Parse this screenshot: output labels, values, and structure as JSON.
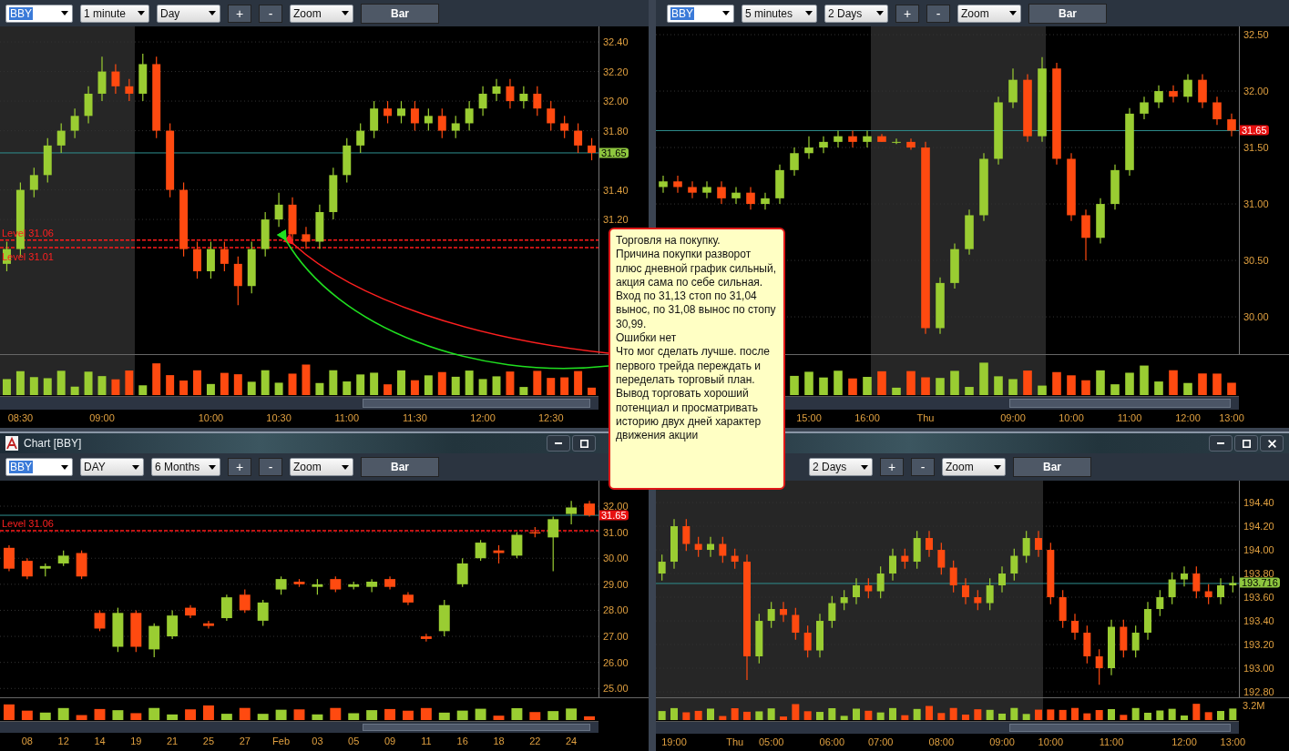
{
  "panels": [
    {
      "toolbar": [
        {
          "kind": "symbol",
          "value": "BBY"
        },
        {
          "kind": "dropdown",
          "value": "1 minute"
        },
        {
          "kind": "dropdown",
          "value": "Day"
        },
        {
          "kind": "button",
          "label": "+"
        },
        {
          "kind": "button",
          "label": "-"
        },
        {
          "kind": "dropdown",
          "value": "Zoom"
        },
        {
          "kind": "bar",
          "label": "Bar"
        }
      ],
      "current_price": {
        "label": "31.65",
        "up": true
      },
      "chart_data": {
        "type": "candlestick",
        "ylim": [
          30.29,
          32.505
        ],
        "yticks": [
          {
            "value": 32.4,
            "label": "32.40"
          },
          {
            "value": 32.2,
            "label": "32.20"
          },
          {
            "value": 32.0,
            "label": "32.00"
          },
          {
            "value": 31.8,
            "label": "31.80"
          },
          {
            "value": 31.4,
            "label": "31.40"
          },
          {
            "value": 31.2,
            "label": "31.20"
          }
        ],
        "grid": true,
        "ref_lines": [
          {
            "axis": "y",
            "value": 31.65,
            "color": "#2f8f8f"
          },
          {
            "axis": "y",
            "value": 31.06,
            "label": "Level 31.06",
            "color": "#ff1a1a"
          },
          {
            "axis": "y",
            "value": 31.01,
            "label": "Level 31.01",
            "color": "#ff1a1a"
          }
        ],
        "categories": [
          null,
          "08:30",
          null,
          null,
          null,
          null,
          null,
          "09:00",
          null,
          null,
          null,
          null,
          null,
          null,
          null,
          "10:00",
          null,
          null,
          null,
          null,
          "10:30",
          null,
          null,
          null,
          null,
          "11:00",
          null,
          null,
          null,
          null,
          "11:30",
          null,
          null,
          null,
          null,
          "12:00",
          null,
          null,
          null,
          null,
          "12:30",
          null,
          null,
          null
        ],
        "ohlc": [
          [
            30.9,
            31.05,
            30.85,
            31.0
          ],
          [
            31.0,
            31.45,
            30.95,
            31.4
          ],
          [
            31.4,
            31.55,
            31.35,
            31.5
          ],
          [
            31.5,
            31.75,
            31.45,
            31.7
          ],
          [
            31.7,
            31.85,
            31.65,
            31.8
          ],
          [
            31.8,
            31.95,
            31.75,
            31.9
          ],
          [
            31.9,
            32.1,
            31.85,
            32.05
          ],
          [
            32.05,
            32.3,
            32.0,
            32.2
          ],
          [
            32.2,
            32.25,
            32.05,
            32.1
          ],
          [
            32.1,
            32.15,
            32.0,
            32.05
          ],
          [
            32.05,
            32.32,
            32.0,
            32.25
          ],
          [
            32.25,
            32.3,
            31.75,
            31.8
          ],
          [
            31.8,
            31.85,
            31.35,
            31.4
          ],
          [
            31.4,
            31.45,
            30.95,
            31.0
          ],
          [
            31.0,
            31.05,
            30.8,
            30.85
          ],
          [
            30.85,
            31.05,
            30.8,
            31.0
          ],
          [
            31.0,
            31.05,
            30.85,
            30.9
          ],
          [
            30.9,
            30.95,
            30.62,
            30.75
          ],
          [
            30.75,
            31.05,
            30.7,
            31.0
          ],
          [
            31.0,
            31.25,
            30.95,
            31.2
          ],
          [
            31.2,
            31.38,
            31.15,
            31.3
          ],
          [
            31.3,
            31.35,
            31.05,
            31.1
          ],
          [
            31.1,
            31.15,
            31.0,
            31.05
          ],
          [
            31.05,
            31.3,
            31.0,
            31.25
          ],
          [
            31.25,
            31.55,
            31.2,
            31.5
          ],
          [
            31.5,
            31.75,
            31.45,
            31.7
          ],
          [
            31.7,
            31.85,
            31.65,
            31.8
          ],
          [
            31.8,
            32.0,
            31.75,
            31.95
          ],
          [
            31.95,
            32.0,
            31.85,
            31.9
          ],
          [
            31.9,
            32.0,
            31.85,
            31.95
          ],
          [
            31.95,
            32.0,
            31.8,
            31.85
          ],
          [
            31.85,
            31.95,
            31.8,
            31.9
          ],
          [
            31.9,
            31.95,
            31.75,
            31.8
          ],
          [
            31.8,
            31.9,
            31.75,
            31.85
          ],
          [
            31.85,
            32.0,
            31.8,
            31.95
          ],
          [
            31.95,
            32.1,
            31.9,
            32.05
          ],
          [
            32.05,
            32.15,
            32.0,
            32.1
          ],
          [
            32.1,
            32.15,
            31.95,
            32.0
          ],
          [
            32.0,
            32.1,
            31.95,
            32.05
          ],
          [
            32.05,
            32.1,
            31.9,
            31.95
          ],
          [
            31.95,
            32.0,
            31.8,
            31.85
          ],
          [
            31.85,
            31.9,
            31.75,
            31.8
          ],
          [
            31.8,
            31.85,
            31.65,
            31.7
          ],
          [
            31.7,
            31.75,
            31.6,
            31.65
          ]
        ]
      }
    },
    {
      "toolbar": [
        {
          "kind": "symbol",
          "value": "BBY"
        },
        {
          "kind": "dropdown",
          "value": "5 minutes"
        },
        {
          "kind": "dropdown",
          "value": "2 Days"
        },
        {
          "kind": "button",
          "label": "+"
        },
        {
          "kind": "button",
          "label": "-"
        },
        {
          "kind": "dropdown",
          "value": "Zoom"
        },
        {
          "kind": "bar",
          "label": "Bar"
        }
      ],
      "current_price": {
        "label": "31.65",
        "up": false
      },
      "chart_data": {
        "type": "candlestick",
        "ylim": [
          29.67,
          32.573
        ],
        "yticks": [
          {
            "value": 32.5,
            "label": "32.50"
          },
          {
            "value": 32.0,
            "label": "32.00"
          },
          {
            "value": 31.5,
            "label": "31.50"
          },
          {
            "value": 31.0,
            "label": "31.00"
          },
          {
            "value": 30.5,
            "label": "30.50"
          },
          {
            "value": 30.0,
            "label": "30.00"
          }
        ],
        "grid": true,
        "ref_lines": [
          {
            "axis": "y",
            "value": 31.65,
            "color": "#2f8f8f"
          }
        ],
        "categories": [
          null,
          null,
          null,
          null,
          null,
          null,
          null,
          null,
          null,
          null,
          "15:00",
          null,
          null,
          null,
          "16:00",
          null,
          null,
          null,
          "Thu",
          null,
          null,
          null,
          null,
          null,
          "09:00",
          null,
          null,
          null,
          "10:00",
          null,
          null,
          null,
          "11:00",
          null,
          null,
          null,
          "12:00",
          null,
          null,
          "13:00"
        ],
        "ohlc": [
          [
            31.15,
            31.25,
            31.1,
            31.2
          ],
          [
            31.2,
            31.25,
            31.1,
            31.15
          ],
          [
            31.15,
            31.2,
            31.05,
            31.1
          ],
          [
            31.1,
            31.2,
            31.05,
            31.15
          ],
          [
            31.15,
            31.2,
            31.0,
            31.05
          ],
          [
            31.05,
            31.15,
            31.0,
            31.1
          ],
          [
            31.1,
            31.15,
            30.95,
            31.0
          ],
          [
            31.0,
            31.1,
            30.95,
            31.05
          ],
          [
            31.05,
            31.35,
            31.0,
            31.3
          ],
          [
            31.3,
            31.5,
            31.25,
            31.45
          ],
          [
            31.45,
            31.6,
            31.4,
            31.5
          ],
          [
            31.5,
            31.6,
            31.45,
            31.55
          ],
          [
            31.55,
            31.65,
            31.5,
            31.6
          ],
          [
            31.6,
            31.65,
            31.5,
            31.55
          ],
          [
            31.55,
            31.65,
            31.5,
            31.6
          ],
          [
            31.6,
            31.62,
            31.55,
            31.55
          ],
          [
            31.55,
            31.58,
            31.53,
            31.55
          ],
          [
            31.55,
            31.58,
            31.48,
            31.5
          ],
          [
            31.5,
            31.55,
            29.85,
            29.9
          ],
          [
            29.9,
            30.35,
            29.85,
            30.3
          ],
          [
            30.3,
            30.65,
            30.25,
            30.6
          ],
          [
            30.6,
            30.95,
            30.55,
            30.9
          ],
          [
            30.9,
            31.45,
            30.85,
            31.4
          ],
          [
            31.4,
            31.95,
            31.35,
            31.9
          ],
          [
            31.9,
            32.2,
            31.85,
            32.1
          ],
          [
            32.1,
            32.15,
            31.55,
            31.6
          ],
          [
            31.6,
            32.3,
            31.55,
            32.2
          ],
          [
            32.2,
            32.25,
            31.35,
            31.4
          ],
          [
            31.4,
            31.45,
            30.85,
            30.9
          ],
          [
            30.9,
            30.95,
            30.5,
            30.7
          ],
          [
            30.7,
            31.05,
            30.65,
            31.0
          ],
          [
            31.0,
            31.35,
            30.95,
            31.3
          ],
          [
            31.3,
            31.85,
            31.25,
            31.8
          ],
          [
            31.8,
            31.95,
            31.75,
            31.9
          ],
          [
            31.9,
            32.05,
            31.85,
            32.0
          ],
          [
            32.0,
            32.05,
            31.9,
            31.95
          ],
          [
            31.95,
            32.15,
            31.9,
            32.1
          ],
          [
            32.1,
            32.15,
            31.85,
            31.9
          ],
          [
            31.9,
            31.95,
            31.7,
            31.75
          ],
          [
            31.75,
            31.8,
            31.6,
            31.65
          ]
        ]
      }
    },
    {
      "title": "Chart [BBY]",
      "window_buttons": [
        {
          "kind": "minimize"
        },
        {
          "kind": "maximize"
        }
      ],
      "toolbar": [
        {
          "kind": "symbol",
          "value": "BBY"
        },
        {
          "kind": "dropdown",
          "value": "DAY"
        },
        {
          "kind": "dropdown",
          "value": "6 Months"
        },
        {
          "kind": "button",
          "label": "+"
        },
        {
          "kind": "button",
          "label": "-"
        },
        {
          "kind": "dropdown",
          "value": "Zoom"
        },
        {
          "kind": "bar",
          "label": "Bar"
        }
      ],
      "current_price": {
        "label": "31.65",
        "up": false
      },
      "chart_data": {
        "type": "candlestick",
        "ylim": [
          24.66,
          32.98
        ],
        "yticks": [
          {
            "value": 32,
            "label": "32.00"
          },
          {
            "value": 31,
            "label": "31.00"
          },
          {
            "value": 30,
            "label": "30.00"
          },
          {
            "value": 29,
            "label": "29.00"
          },
          {
            "value": 28,
            "label": "28.00"
          },
          {
            "value": 27,
            "label": "27.00"
          },
          {
            "value": 26,
            "label": "26.00"
          },
          {
            "value": 25,
            "label": "25.00"
          }
        ],
        "grid": true,
        "ref_lines": [
          {
            "axis": "y",
            "value": 31.65,
            "color": "#2f8f8f"
          },
          {
            "axis": "y",
            "value": 31.06,
            "label": "Level 31.06",
            "color": "#ff1a1a"
          }
        ],
        "categories": [
          null,
          "08",
          null,
          "12",
          null,
          "14",
          null,
          "19",
          null,
          "21",
          null,
          "25",
          null,
          "27",
          null,
          "Feb",
          null,
          "03",
          null,
          "05",
          null,
          "09",
          null,
          "11",
          null,
          "16",
          null,
          "18",
          null,
          "22",
          null,
          "24",
          null
        ],
        "ohlc": [
          [
            30.4,
            30.5,
            29.5,
            29.6
          ],
          [
            29.9,
            30.0,
            29.2,
            29.3
          ],
          [
            29.6,
            29.8,
            29.3,
            29.7
          ],
          [
            29.8,
            30.3,
            29.7,
            30.1
          ],
          [
            30.2,
            30.3,
            29.2,
            29.3
          ],
          [
            27.9,
            28.0,
            27.2,
            27.3
          ],
          [
            26.6,
            28.1,
            26.4,
            27.9
          ],
          [
            27.9,
            28.0,
            26.4,
            26.6
          ],
          [
            26.5,
            27.5,
            26.2,
            27.4
          ],
          [
            27.0,
            28.0,
            26.9,
            27.8
          ],
          [
            28.1,
            28.2,
            27.7,
            27.8
          ],
          [
            27.5,
            27.6,
            27.3,
            27.4
          ],
          [
            27.7,
            28.6,
            27.6,
            28.5
          ],
          [
            28.6,
            28.8,
            27.9,
            28.0
          ],
          [
            27.6,
            28.4,
            27.4,
            28.3
          ],
          [
            28.8,
            29.3,
            28.6,
            29.2
          ],
          [
            29.1,
            29.2,
            28.9,
            29.0
          ],
          [
            28.9,
            29.2,
            28.6,
            29.0
          ],
          [
            29.2,
            29.3,
            28.7,
            28.8
          ],
          [
            28.9,
            29.1,
            28.8,
            29.0
          ],
          [
            28.9,
            29.2,
            28.7,
            29.1
          ],
          [
            29.2,
            29.3,
            28.8,
            28.9
          ],
          [
            28.6,
            28.7,
            28.2,
            28.3
          ],
          [
            27.0,
            27.1,
            26.8,
            26.9
          ],
          [
            27.2,
            28.4,
            27.0,
            28.2
          ],
          [
            29.0,
            30.0,
            28.9,
            29.8
          ],
          [
            30.0,
            30.7,
            29.9,
            30.6
          ],
          [
            30.3,
            30.5,
            29.8,
            30.2
          ],
          [
            30.1,
            31.0,
            30.0,
            30.9
          ],
          [
            31.0,
            31.2,
            30.8,
            30.95
          ],
          [
            30.8,
            31.6,
            29.5,
            31.5
          ],
          [
            31.7,
            32.2,
            31.3,
            31.95
          ],
          [
            32.1,
            32.2,
            31.6,
            31.65
          ]
        ]
      }
    },
    {
      "window_buttons": [
        {
          "kind": "minimize"
        },
        {
          "kind": "maximize"
        },
        {
          "kind": "close"
        }
      ],
      "toolbar": [
        {
          "kind": "dropdown",
          "value": "2 Days"
        },
        {
          "kind": "button",
          "label": "+"
        },
        {
          "kind": "button",
          "label": "-"
        },
        {
          "kind": "dropdown",
          "value": "Zoom"
        },
        {
          "kind": "bar",
          "label": "Bar"
        }
      ],
      "current_price": {
        "label": "193.716",
        "up": true
      },
      "volume_label": "3.2M",
      "chart_data": {
        "type": "candlestick",
        "ylim": [
          192.754,
          194.585
        ],
        "yticks": [
          {
            "value": 194.4,
            "label": "194.40"
          },
          {
            "value": 194.2,
            "label": "194.20"
          },
          {
            "value": 194.0,
            "label": "194.00"
          },
          {
            "value": 193.8,
            "label": "193.80"
          },
          {
            "value": 193.6,
            "label": "193.60"
          },
          {
            "value": 193.4,
            "label": "193.40"
          },
          {
            "value": 193.2,
            "label": "193.20"
          },
          {
            "value": 193.0,
            "label": "193.00"
          },
          {
            "value": 192.8,
            "label": "192.80"
          }
        ],
        "grid": true,
        "ref_lines": [
          {
            "axis": "y",
            "value": 193.716,
            "color": "#2f8f8f"
          }
        ],
        "categories": [
          null,
          "19:00",
          null,
          null,
          null,
          null,
          "Thu",
          null,
          null,
          "05:00",
          null,
          null,
          null,
          null,
          "06:00",
          null,
          null,
          null,
          "07:00",
          null,
          null,
          null,
          null,
          "08:00",
          null,
          null,
          null,
          null,
          "09:00",
          null,
          null,
          null,
          "10:00",
          null,
          null,
          null,
          null,
          "11:00",
          null,
          null,
          null,
          null,
          null,
          "12:00",
          null,
          null,
          null,
          "13:00"
        ],
        "ohlc": [
          [
            193.8,
            193.96,
            193.74,
            193.9
          ],
          [
            193.9,
            194.26,
            193.84,
            194.2
          ],
          [
            194.2,
            194.26,
            193.99,
            194.05
          ],
          [
            194.05,
            194.11,
            193.94,
            194.0
          ],
          [
            194.0,
            194.11,
            193.94,
            194.05
          ],
          [
            194.05,
            194.11,
            193.89,
            193.95
          ],
          [
            193.95,
            194.01,
            193.84,
            193.9
          ],
          [
            193.9,
            193.96,
            192.9,
            193.1
          ],
          [
            193.1,
            193.46,
            193.04,
            193.4
          ],
          [
            193.4,
            193.56,
            193.34,
            193.5
          ],
          [
            193.5,
            193.56,
            193.39,
            193.45
          ],
          [
            193.45,
            193.51,
            193.24,
            193.3
          ],
          [
            193.3,
            193.36,
            193.09,
            193.15
          ],
          [
            193.15,
            193.46,
            193.09,
            193.4
          ],
          [
            193.4,
            193.61,
            193.34,
            193.55
          ],
          [
            193.55,
            193.66,
            193.49,
            193.6
          ],
          [
            193.6,
            193.76,
            193.54,
            193.7
          ],
          [
            193.7,
            193.76,
            193.59,
            193.65
          ],
          [
            193.65,
            193.86,
            193.59,
            193.8
          ],
          [
            193.8,
            194.01,
            193.74,
            193.95
          ],
          [
            193.95,
            194.01,
            193.84,
            193.9
          ],
          [
            193.9,
            194.16,
            193.84,
            194.1
          ],
          [
            194.1,
            194.16,
            193.94,
            194.0
          ],
          [
            194.0,
            194.06,
            193.79,
            193.85
          ],
          [
            193.85,
            193.91,
            193.64,
            193.7
          ],
          [
            193.7,
            193.76,
            193.54,
            193.6
          ],
          [
            193.6,
            193.66,
            193.49,
            193.55
          ],
          [
            193.55,
            193.76,
            193.49,
            193.7
          ],
          [
            193.7,
            193.86,
            193.64,
            193.8
          ],
          [
            193.8,
            194.01,
            193.74,
            193.95
          ],
          [
            193.95,
            194.16,
            193.89,
            194.1
          ],
          [
            194.1,
            194.16,
            193.94,
            194.0
          ],
          [
            194.0,
            194.06,
            193.54,
            193.6
          ],
          [
            193.6,
            193.66,
            193.34,
            193.4
          ],
          [
            193.4,
            193.46,
            193.24,
            193.3
          ],
          [
            193.3,
            193.36,
            193.04,
            193.1
          ],
          [
            193.1,
            193.16,
            192.86,
            193.0
          ],
          [
            193.0,
            193.41,
            192.94,
            193.35
          ],
          [
            193.35,
            193.41,
            193.09,
            193.15
          ],
          [
            193.15,
            193.36,
            193.09,
            193.3
          ],
          [
            193.3,
            193.56,
            193.24,
            193.5
          ],
          [
            193.5,
            193.66,
            193.44,
            193.6
          ],
          [
            193.6,
            193.81,
            193.54,
            193.75
          ],
          [
            193.75,
            193.86,
            193.69,
            193.8
          ],
          [
            193.8,
            193.86,
            193.59,
            193.65
          ],
          [
            193.65,
            193.71,
            193.54,
            193.6
          ],
          [
            193.6,
            193.76,
            193.54,
            193.7
          ],
          [
            193.7,
            193.78,
            193.64,
            193.72
          ]
        ]
      }
    }
  ],
  "note": {
    "text": "Торговля на покупку.\nПричина покупки разворот плюс дневной график сильный, акция сама по себе сильная.\nВход по 31,13 стоп по 31,04 вынос, по 31,08 вынос по стопу 30,99.\nОшибки нет\nЧто мог сделать лучше. после первого трейда переждать и переделать торговый план.\nВывод торговать хороший потенциал и просматривать историю двух дней характер движения акции"
  }
}
